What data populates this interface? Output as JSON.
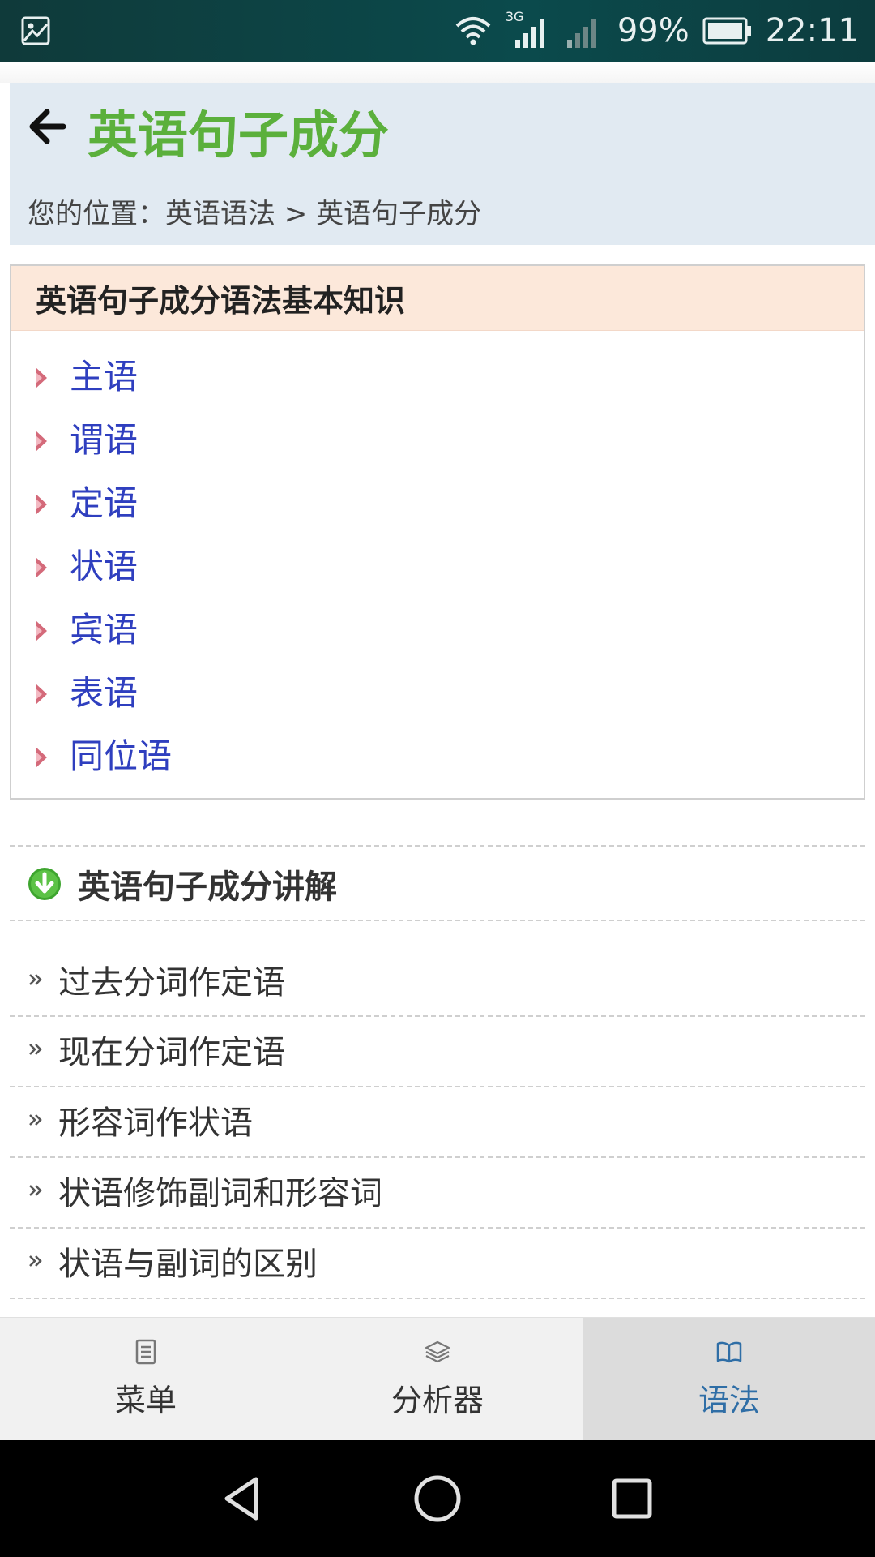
{
  "status_bar": {
    "network": "3G",
    "battery": "99%",
    "time": "22:11"
  },
  "header": {
    "title": "英语句子成分",
    "breadcrumb_prefix": "您的位置：",
    "breadcrumb_parent": "英语语法",
    "breadcrumb_sep": " > ",
    "breadcrumb_current": "英语句子成分"
  },
  "knowledge": {
    "title": "英语句子成分语法基本知识",
    "items": [
      {
        "label": "主语"
      },
      {
        "label": "谓语"
      },
      {
        "label": "定语"
      },
      {
        "label": "状语"
      },
      {
        "label": "宾语"
      },
      {
        "label": "表语"
      },
      {
        "label": "同位语"
      }
    ]
  },
  "explain": {
    "title": "英语句子成分讲解",
    "items": [
      {
        "label": "过去分词作定语"
      },
      {
        "label": "现在分词作定语"
      },
      {
        "label": "形容词作状语"
      },
      {
        "label": "状语修饰副词和形容词"
      },
      {
        "label": "状语与副词的区别"
      }
    ]
  },
  "tabs": [
    {
      "label": "菜单",
      "icon": "document-icon",
      "active": false
    },
    {
      "label": "分析器",
      "icon": "layers-icon",
      "active": false
    },
    {
      "label": "语法",
      "icon": "book-icon",
      "active": true
    }
  ],
  "colors": {
    "title_green": "#5bb03c",
    "link_blue": "#2f3fbf",
    "header_bg": "#e1eaf2",
    "box_head_bg": "#fce8da",
    "active_tab_text": "#2f6ea6"
  }
}
